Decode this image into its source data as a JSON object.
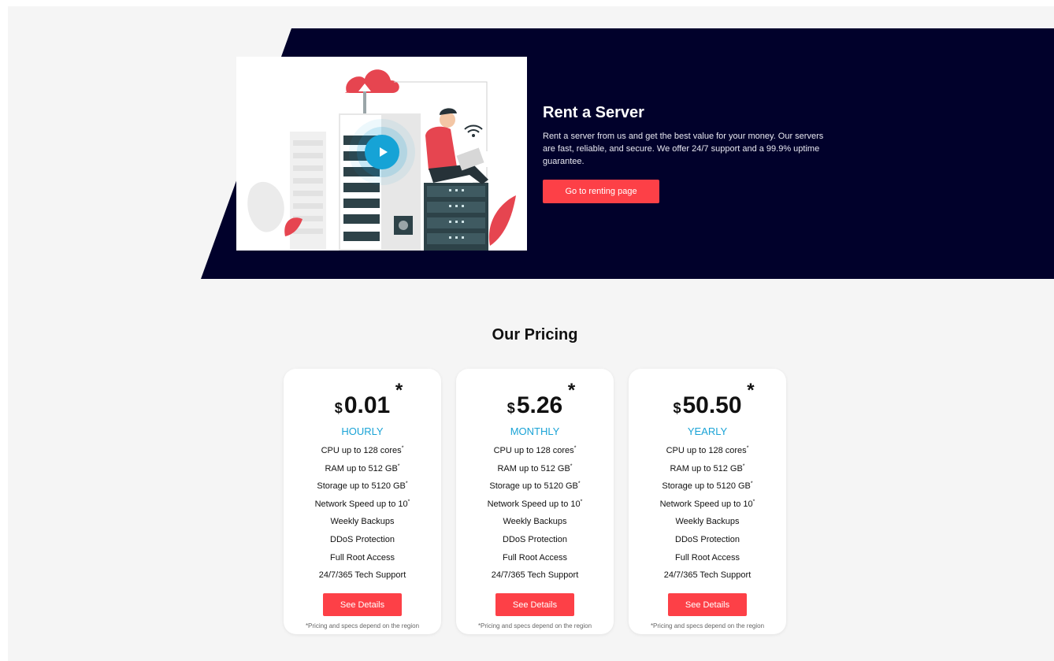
{
  "hero": {
    "title": "Rent a Server",
    "description": "Rent a server from us and get the best value for your money. Our servers are fast, reliable, and secure. We offer 24/7 support and a 99.9% uptime guarantee.",
    "cta_label": "Go to renting page",
    "image_icon": "server-illustration",
    "play_icon": "play-icon"
  },
  "pricing": {
    "title": "Our Pricing",
    "currency": "$",
    "asterisk": "*",
    "plans": [
      {
        "amount": "0.01",
        "period": "HOURLY",
        "features": [
          {
            "text": "CPU up to 128 cores",
            "note": "*"
          },
          {
            "text": "RAM up to 512 GB",
            "note": "*"
          },
          {
            "text": "Storage up to 5120 GB",
            "note": "*"
          },
          {
            "text": "Network Speed up to 10",
            "note": "*"
          },
          {
            "text": "Weekly Backups",
            "note": ""
          },
          {
            "text": "DDoS Protection",
            "note": ""
          },
          {
            "text": "Full Root Access",
            "note": ""
          },
          {
            "text": "24/7/365 Tech Support",
            "note": ""
          }
        ],
        "button_label": "See Details",
        "footnote": "*Pricing and specs depend on the region"
      },
      {
        "amount": "5.26",
        "period": "MONTHLY",
        "features": [
          {
            "text": "CPU up to 128 cores",
            "note": "*"
          },
          {
            "text": "RAM up to 512 GB",
            "note": "*"
          },
          {
            "text": "Storage up to 5120 GB",
            "note": "*"
          },
          {
            "text": "Network Speed up to 10",
            "note": "*"
          },
          {
            "text": "Weekly Backups",
            "note": ""
          },
          {
            "text": "DDoS Protection",
            "note": ""
          },
          {
            "text": "Full Root Access",
            "note": ""
          },
          {
            "text": "24/7/365 Tech Support",
            "note": ""
          }
        ],
        "button_label": "See Details",
        "footnote": "*Pricing and specs depend on the region"
      },
      {
        "amount": "50.50",
        "period": "YEARLY",
        "features": [
          {
            "text": "CPU up to 128 cores",
            "note": "*"
          },
          {
            "text": "RAM up to 512 GB",
            "note": "*"
          },
          {
            "text": "Storage up to 5120 GB",
            "note": "*"
          },
          {
            "text": "Network Speed up to 10",
            "note": "*"
          },
          {
            "text": "Weekly Backups",
            "note": ""
          },
          {
            "text": "DDoS Protection",
            "note": ""
          },
          {
            "text": "Full Root Access",
            "note": ""
          },
          {
            "text": "24/7/365 Tech Support",
            "note": ""
          }
        ],
        "button_label": "See Details",
        "footnote": "*Pricing and specs depend on the region"
      }
    ]
  },
  "colors": {
    "hero_bg": "#01012b",
    "accent_red": "#fd4047",
    "accent_blue": "#1aa3d6",
    "page_bg": "#f5f5f5"
  }
}
